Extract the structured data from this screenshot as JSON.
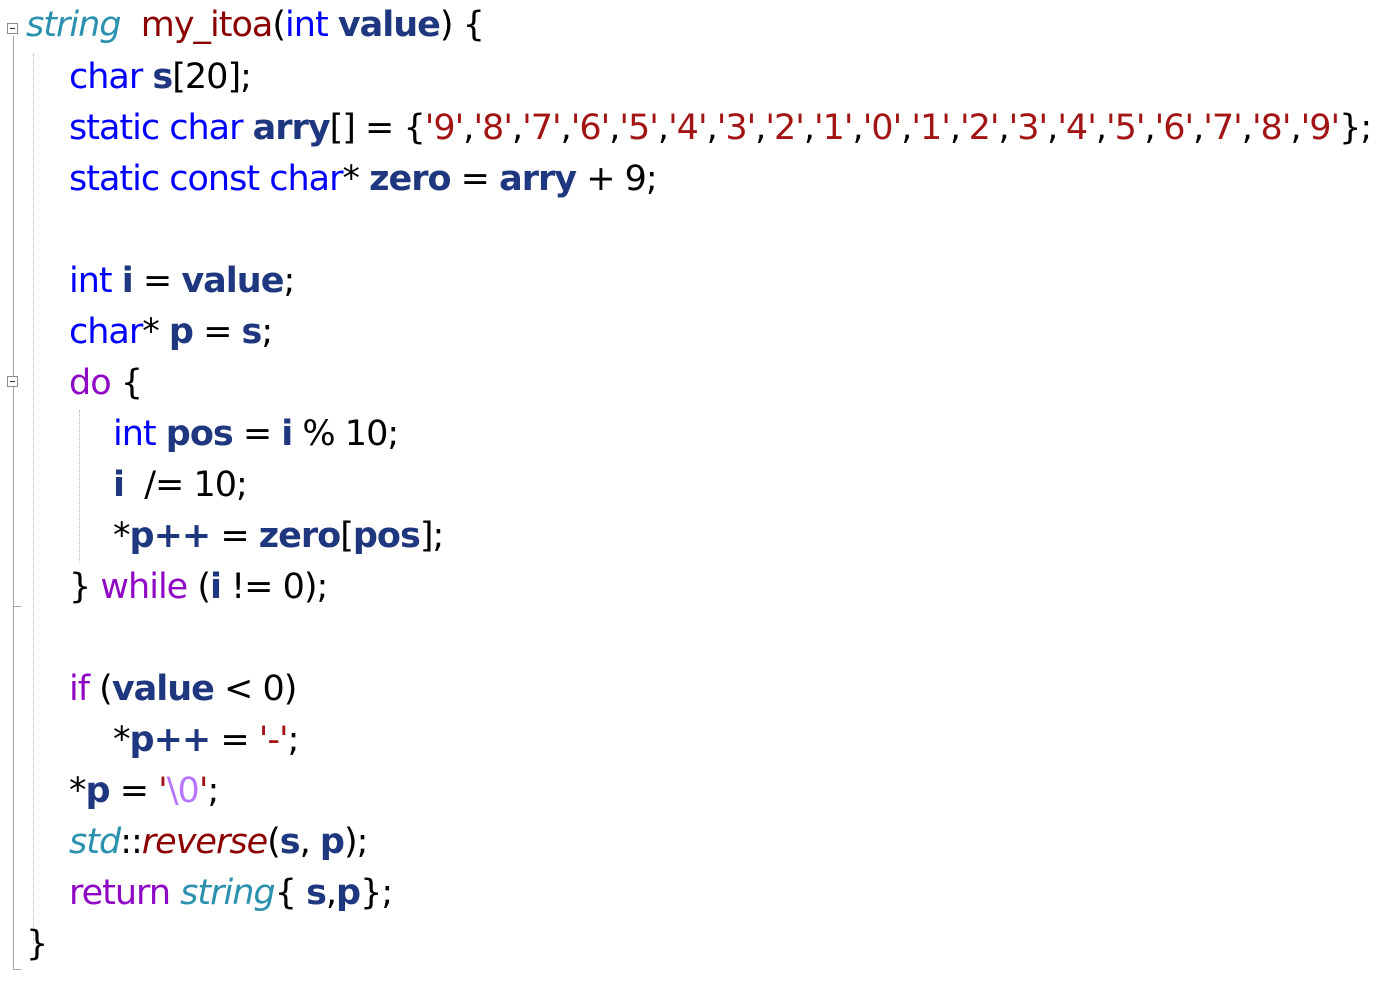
{
  "editor": {
    "language": "C++",
    "fold_markers": [
      "function-fold",
      "do-fold"
    ],
    "lines": [
      [
        {
          "t": "string",
          "c": "type"
        },
        {
          "t": "  ",
          "c": "op"
        },
        {
          "t": "my_itoa",
          "c": "fn-red"
        },
        {
          "t": "(",
          "c": "op"
        },
        {
          "t": "int",
          "c": "kw"
        },
        {
          "t": " ",
          "c": "op"
        },
        {
          "t": "value",
          "c": "param"
        },
        {
          "t": ") {",
          "c": "op"
        }
      ],
      [
        {
          "t": "char",
          "c": "kw"
        },
        {
          "t": " ",
          "c": "op"
        },
        {
          "t": "s",
          "c": "var"
        },
        {
          "t": "[20];",
          "c": "op"
        }
      ],
      [
        {
          "t": "static",
          "c": "kw"
        },
        {
          "t": " ",
          "c": "op"
        },
        {
          "t": "char",
          "c": "kw"
        },
        {
          "t": " ",
          "c": "op"
        },
        {
          "t": "arry",
          "c": "var"
        },
        {
          "t": "[] = {",
          "c": "op"
        },
        {
          "t": "'9'",
          "c": "str"
        },
        {
          "t": ",",
          "c": "op"
        },
        {
          "t": "'8'",
          "c": "str"
        },
        {
          "t": ",",
          "c": "op"
        },
        {
          "t": "'7'",
          "c": "str"
        },
        {
          "t": ",",
          "c": "op"
        },
        {
          "t": "'6'",
          "c": "str"
        },
        {
          "t": ",",
          "c": "op"
        },
        {
          "t": "'5'",
          "c": "str"
        },
        {
          "t": ",",
          "c": "op"
        },
        {
          "t": "'4'",
          "c": "str"
        },
        {
          "t": ",",
          "c": "op"
        },
        {
          "t": "'3'",
          "c": "str"
        },
        {
          "t": ",",
          "c": "op"
        },
        {
          "t": "'2'",
          "c": "str"
        },
        {
          "t": ",",
          "c": "op"
        },
        {
          "t": "'1'",
          "c": "str"
        },
        {
          "t": ",",
          "c": "op"
        },
        {
          "t": "'0'",
          "c": "str"
        },
        {
          "t": ",",
          "c": "op"
        },
        {
          "t": "'1'",
          "c": "str"
        },
        {
          "t": ",",
          "c": "op"
        },
        {
          "t": "'2'",
          "c": "str"
        },
        {
          "t": ",",
          "c": "op"
        },
        {
          "t": "'3'",
          "c": "str"
        },
        {
          "t": ",",
          "c": "op"
        },
        {
          "t": "'4'",
          "c": "str"
        },
        {
          "t": ",",
          "c": "op"
        },
        {
          "t": "'5'",
          "c": "str"
        },
        {
          "t": ",",
          "c": "op"
        },
        {
          "t": "'6'",
          "c": "str"
        },
        {
          "t": ",",
          "c": "op"
        },
        {
          "t": "'7'",
          "c": "str"
        },
        {
          "t": ",",
          "c": "op"
        },
        {
          "t": "'8'",
          "c": "str"
        },
        {
          "t": ",",
          "c": "op"
        },
        {
          "t": "'9'",
          "c": "str"
        },
        {
          "t": "};",
          "c": "op"
        }
      ],
      [
        {
          "t": "static",
          "c": "kw"
        },
        {
          "t": " ",
          "c": "op"
        },
        {
          "t": "const",
          "c": "kw"
        },
        {
          "t": " ",
          "c": "op"
        },
        {
          "t": "char",
          "c": "kw"
        },
        {
          "t": "* ",
          "c": "op"
        },
        {
          "t": "zero",
          "c": "var"
        },
        {
          "t": " = ",
          "c": "op"
        },
        {
          "t": "arry",
          "c": "var"
        },
        {
          "t": " + 9;",
          "c": "op"
        }
      ],
      [],
      [
        {
          "t": "int",
          "c": "kw"
        },
        {
          "t": " ",
          "c": "op"
        },
        {
          "t": "i",
          "c": "var"
        },
        {
          "t": " = ",
          "c": "op"
        },
        {
          "t": "value",
          "c": "param"
        },
        {
          "t": ";",
          "c": "op"
        }
      ],
      [
        {
          "t": "char",
          "c": "kw"
        },
        {
          "t": "* ",
          "c": "op"
        },
        {
          "t": "p",
          "c": "var"
        },
        {
          "t": " = ",
          "c": "op"
        },
        {
          "t": "s",
          "c": "var"
        },
        {
          "t": ";",
          "c": "op"
        }
      ],
      [
        {
          "t": "do",
          "c": "ctl"
        },
        {
          "t": " {",
          "c": "op"
        }
      ],
      [
        {
          "t": "int",
          "c": "kw"
        },
        {
          "t": " ",
          "c": "op"
        },
        {
          "t": "pos",
          "c": "var"
        },
        {
          "t": " = ",
          "c": "op"
        },
        {
          "t": "i",
          "c": "var"
        },
        {
          "t": " % 10;",
          "c": "op"
        }
      ],
      [
        {
          "t": "i",
          "c": "var"
        },
        {
          "t": "  /= 10;",
          "c": "op"
        }
      ],
      [
        {
          "t": "*",
          "c": "op"
        },
        {
          "t": "p",
          "c": "var"
        },
        {
          "t": "++",
          "c": "var"
        },
        {
          "t": " = ",
          "c": "op"
        },
        {
          "t": "zero",
          "c": "var"
        },
        {
          "t": "[",
          "c": "op"
        },
        {
          "t": "pos",
          "c": "var"
        },
        {
          "t": "];",
          "c": "op"
        }
      ],
      [
        {
          "t": "} ",
          "c": "op"
        },
        {
          "t": "while",
          "c": "ctl"
        },
        {
          "t": " (",
          "c": "op"
        },
        {
          "t": "i",
          "c": "var"
        },
        {
          "t": " != 0);",
          "c": "op"
        }
      ],
      [],
      [
        {
          "t": "if",
          "c": "ctl"
        },
        {
          "t": " (",
          "c": "op"
        },
        {
          "t": "value",
          "c": "param"
        },
        {
          "t": " < 0)",
          "c": "op"
        }
      ],
      [
        {
          "t": "*",
          "c": "op"
        },
        {
          "t": "p",
          "c": "var"
        },
        {
          "t": "++",
          "c": "var"
        },
        {
          "t": " = ",
          "c": "op"
        },
        {
          "t": "'-'",
          "c": "str"
        },
        {
          "t": ";",
          "c": "op"
        }
      ],
      [
        {
          "t": "*",
          "c": "op"
        },
        {
          "t": "p",
          "c": "var"
        },
        {
          "t": " = ",
          "c": "op"
        },
        {
          "t": "'",
          "c": "str"
        },
        {
          "t": "\\0",
          "c": "esc"
        },
        {
          "t": "'",
          "c": "str"
        },
        {
          "t": ";",
          "c": "op"
        }
      ],
      [
        {
          "t": "std",
          "c": "ns"
        },
        {
          "t": "::",
          "c": "op"
        },
        {
          "t": "reverse",
          "c": "fn-red-i"
        },
        {
          "t": "(",
          "c": "op"
        },
        {
          "t": "s",
          "c": "var"
        },
        {
          "t": ", ",
          "c": "op"
        },
        {
          "t": "p",
          "c": "var"
        },
        {
          "t": ");",
          "c": "op"
        }
      ],
      [
        {
          "t": "return",
          "c": "ctl"
        },
        {
          "t": " ",
          "c": "op"
        },
        {
          "t": "string",
          "c": "type"
        },
        {
          "t": "{ ",
          "c": "op"
        },
        {
          "t": "s",
          "c": "var"
        },
        {
          "t": ",",
          "c": "op"
        },
        {
          "t": "p",
          "c": "var"
        },
        {
          "t": "};",
          "c": "op"
        }
      ],
      [
        {
          "t": "}",
          "c": "op"
        }
      ]
    ]
  }
}
